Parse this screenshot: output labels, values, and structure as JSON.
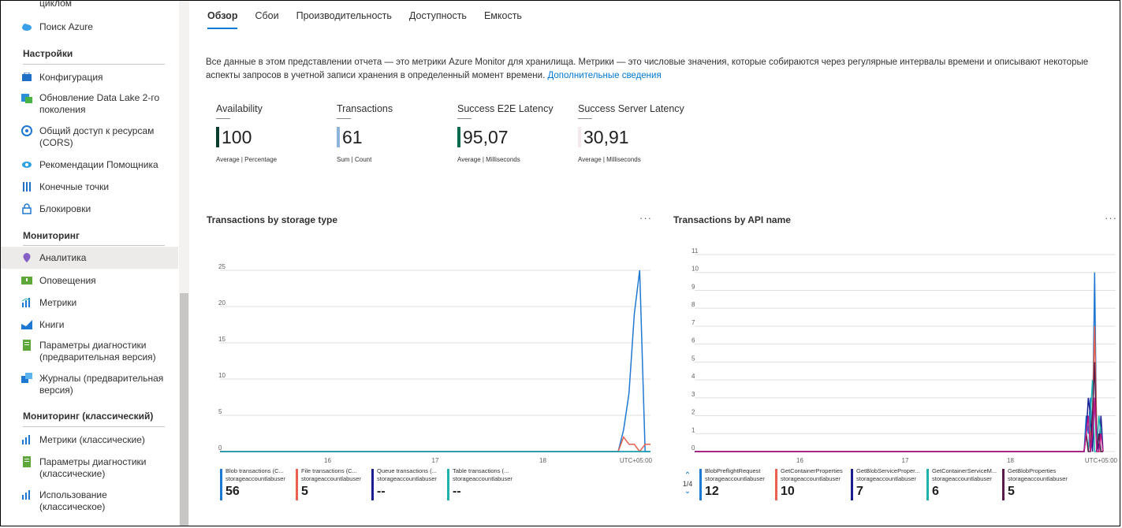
{
  "sidebar": {
    "items": [
      {
        "label": "циклом"
      },
      {
        "label": "Поиск Azure"
      },
      {
        "label": "Конфигурация"
      },
      {
        "label": "Обновление Data Lake 2-го поколения"
      },
      {
        "label": "Общий доступ к ресурсам (CORS)"
      },
      {
        "label": "Рекомендации Помощника"
      },
      {
        "label": "Конечные точки"
      },
      {
        "label": "Блокировки"
      },
      {
        "label": "Аналитика"
      },
      {
        "label": "Оповещения"
      },
      {
        "label": "Метрики"
      },
      {
        "label": "Книги"
      },
      {
        "label": "Параметры диагностики (предварительная версия)"
      },
      {
        "label": "Журналы (предварительная версия)"
      },
      {
        "label": "Метрики (классические)"
      },
      {
        "label": "Параметры диагностики (классические)"
      },
      {
        "label": "Использование (классическое)"
      }
    ],
    "sections": [
      "Настройки",
      "Мониторинг",
      "Мониторинг (классический)"
    ]
  },
  "tabs": [
    "Обзор",
    "Сбои",
    "Производительность",
    "Доступность",
    "Емкость"
  ],
  "description": {
    "text": "Все данные в этом представлении отчета — это метрики Azure Monitor для хранилища. Метрики — это числовые значения, которые собираются через регулярные интервалы времени и описывают некоторые аспекты запросов в учетной записи хранения в определенный момент времени.",
    "link": "Дополнительные сведения"
  },
  "metrics": [
    {
      "name": "Availability",
      "value": "100",
      "sub": "Average | Percentage",
      "color": "#0b3d2e"
    },
    {
      "name": "Transactions",
      "value": "61",
      "sub": "Sum | Count",
      "color": "#8fb4d9"
    },
    {
      "name": "Success E2E Latency",
      "value": "95,07",
      "sub": "Average | Milliseconds",
      "color": "#0b6b4f"
    },
    {
      "name": "Success Server Latency",
      "value": "30,91",
      "sub": "Average | Milliseconds",
      "color": "#f4e9ef"
    }
  ],
  "chart_data": [
    {
      "type": "line",
      "title": "Transactions by storage type",
      "menu": "···",
      "ylim": [
        0,
        25
      ],
      "yticks": [
        "0",
        "5",
        "10",
        "15",
        "20",
        "25"
      ],
      "xticks": [
        "16",
        "17",
        "18"
      ],
      "timezone": "UTC+05:00",
      "x": [
        15.0,
        15.5,
        16.0,
        16.5,
        17.0,
        17.5,
        18.0,
        18.5,
        18.7,
        18.75,
        18.8,
        18.85,
        18.9,
        18.95,
        19.0
      ],
      "series": [
        {
          "name": "Blob transactions (C...",
          "account": "storageaccountlabuser",
          "total": "56",
          "color": "#1f78d1",
          "values": [
            0,
            0,
            0,
            0,
            0,
            0,
            0,
            0,
            0,
            3,
            8,
            19,
            25,
            0,
            0
          ]
        },
        {
          "name": "File transactions (C...",
          "account": "storageaccountlabuser",
          "total": "5",
          "color": "#e8624f",
          "values": [
            0,
            0,
            0,
            0,
            0,
            0,
            0,
            0,
            0,
            2,
            1,
            1,
            0,
            1,
            1
          ]
        },
        {
          "name": "Queue transactions (...",
          "account": "storageaccountlabuser",
          "total": "--",
          "color": "#1a1f8f",
          "values": [
            0,
            0,
            0,
            0,
            0,
            0,
            0,
            0,
            0,
            0,
            0,
            0,
            0,
            0,
            0
          ]
        },
        {
          "name": "Table transactions (...",
          "account": "storageaccountlabuser",
          "total": "--",
          "color": "#1fb1b1",
          "values": [
            0,
            0,
            0,
            0,
            0,
            0,
            0,
            0,
            0,
            0,
            0,
            0,
            0,
            0,
            0
          ]
        }
      ]
    },
    {
      "type": "line",
      "title": "Transactions by API name",
      "menu": "···",
      "ylim": [
        0,
        11
      ],
      "yticks": [
        "0",
        "1",
        "2",
        "3",
        "4",
        "5",
        "6",
        "7",
        "8",
        "9",
        "10",
        "11"
      ],
      "xticks": [
        "16",
        "17",
        "18"
      ],
      "timezone": "UTC+05:00",
      "x": [
        15.0,
        16.0,
        17.0,
        18.0,
        18.7,
        18.72,
        18.74,
        18.76,
        18.78,
        18.8,
        18.82,
        18.84,
        18.86,
        18.88
      ],
      "series": [
        {
          "name": "BlobPreflightRequest",
          "account": "storageaccountlabuser",
          "total": "12",
          "color": "#1f78d1",
          "values": [
            0,
            0,
            0,
            0,
            0,
            2,
            1,
            3,
            1,
            10,
            0,
            1,
            0,
            0
          ]
        },
        {
          "name": "GetContainerProperties",
          "account": "storageaccountlabuser",
          "total": "10",
          "color": "#e8624f",
          "values": [
            0,
            0,
            0,
            0,
            0,
            1,
            0,
            1,
            2,
            7,
            1,
            0,
            0,
            0
          ]
        },
        {
          "name": "GetBlobServiceProper...",
          "account": "storageaccountlabuser",
          "total": "7",
          "color": "#1a1f8f",
          "values": [
            0,
            0,
            0,
            0,
            0,
            1,
            3,
            2,
            0,
            3,
            1,
            0,
            2,
            0
          ]
        },
        {
          "name": "GetContainerServiceM...",
          "account": "storageaccountlabuser",
          "total": "6",
          "color": "#1fb1b1",
          "values": [
            0,
            0,
            0,
            0,
            0,
            1,
            0,
            2,
            4,
            0,
            0,
            2,
            1,
            0
          ]
        },
        {
          "name": "GetBlobProperties",
          "account": "storageaccountlabuser",
          "total": "5",
          "color": "#5a1a4a",
          "values": [
            0,
            0,
            0,
            0,
            0,
            1,
            0,
            0,
            2,
            5,
            0,
            1,
            0,
            0
          ]
        },
        {
          "name": "",
          "account": "",
          "total": "",
          "color": "#c2188a",
          "values": [
            0,
            0,
            0,
            0,
            0,
            1,
            2,
            0,
            1,
            3,
            0,
            0,
            1,
            0
          ]
        }
      ],
      "pager": "1/4"
    }
  ]
}
